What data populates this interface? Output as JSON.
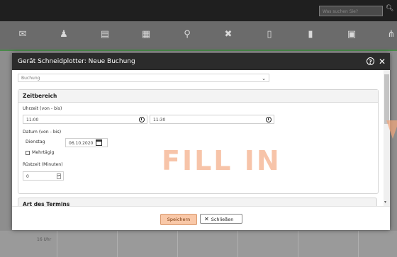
{
  "topbar": {
    "search_placeholder": "Was suchen Sie?"
  },
  "nav_icons": [
    "mail-icon",
    "users-icon",
    "building-icon",
    "calendar-icon",
    "search-icon",
    "tools-icon",
    "document-icon",
    "book-icon",
    "monitor-icon",
    "sitemap-icon"
  ],
  "background": {
    "time_label": "16 Uhr"
  },
  "modal": {
    "title": "Gerät Schneidplotter: Neue Buchung",
    "select_value": "Buchung",
    "section_zeitbereich": "Zeitbereich",
    "uhrzeit_label": "Uhrzeit (von - bis)",
    "time_from": "11:00",
    "time_to": "11:30",
    "datum_label": "Datum (von - bis)",
    "weekday": "Dienstag",
    "date": "06.10.2020",
    "mehrtaegig_label": "Mehrtägig",
    "ruestzeit_label": "Rüstzeit (Minuten)",
    "ruestzeit_value": "0",
    "section_art": "Art des Termins",
    "save_label": "Speichern",
    "close_label": "Schließen"
  },
  "watermark": "FILL IN"
}
